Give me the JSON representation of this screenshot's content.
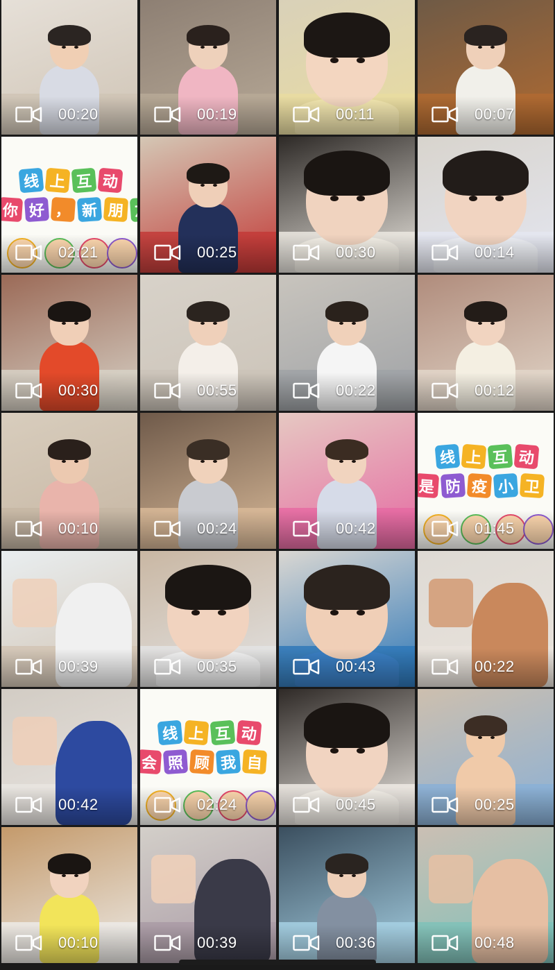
{
  "gallery": {
    "partial_row": [
      {
        "bg": "#d7cfc2"
      },
      {
        "bg": "#6b4d55"
      },
      {
        "bg": "#3e3a36"
      },
      {
        "bg": "#9b6f4a"
      }
    ],
    "tiles": [
      {
        "duration": "00:20",
        "kind": "child",
        "wall": "#e6e0d8",
        "floor": "#cfc4b5",
        "shirt": "#d8dbe4",
        "hair": "#2b2522",
        "skin": "#f0cfb4"
      },
      {
        "duration": "00:19",
        "kind": "child",
        "wall": "#8d7f73",
        "floor": "#b7a997",
        "shirt": "#f0b6c3",
        "hair": "#2a211d",
        "skin": "#eed1bb"
      },
      {
        "duration": "00:11",
        "kind": "closeup",
        "wall": "#d9d1b9",
        "floor": "#e9dca0",
        "shirt": "#f3e7b0",
        "hair": "#1c1714",
        "skin": "#f3d6c0"
      },
      {
        "duration": "00:07",
        "kind": "child",
        "wall": "#6e5a46",
        "floor": "#b06a31",
        "shirt": "#f1f0ea",
        "hair": "#2a2320",
        "skin": "#efd0b9"
      },
      {
        "duration": "02:21",
        "kind": "banner",
        "chars": [
          "线",
          "上",
          "互",
          "动"
        ],
        "chars2": [
          "你",
          "好",
          "，",
          "新",
          "朋",
          "友"
        ]
      },
      {
        "duration": "00:25",
        "kind": "child",
        "wall": "#d4c7b5",
        "floor": "#c23a37",
        "shirt": "#23305a",
        "hair": "#1e1915",
        "skin": "#efcfb8"
      },
      {
        "duration": "00:30",
        "kind": "closeup",
        "wall": "#2e2a27",
        "floor": "#ebe7e0",
        "shirt": "#f3efe6",
        "hair": "#1a1512",
        "skin": "#f0d3bf"
      },
      {
        "duration": "00:14",
        "kind": "closeup",
        "wall": "#d8d4cd",
        "floor": "#e4e6f0",
        "shirt": "#eef0f5",
        "hair": "#221c19",
        "skin": "#f1d4c1"
      },
      {
        "duration": "00:30",
        "kind": "child",
        "wall": "#9b6a57",
        "floor": "#d7d1c6",
        "shirt": "#e34a2a",
        "hair": "#1a1512",
        "skin": "#f0cfb7"
      },
      {
        "duration": "00:55",
        "kind": "child",
        "wall": "#d8d2c9",
        "floor": "#cbc3b8",
        "shirt": "#f4efe9",
        "hair": "#2b241f",
        "skin": "#efd0ba"
      },
      {
        "duration": "00:22",
        "kind": "child",
        "wall": "#c8c4bd",
        "floor": "#9fa2a6",
        "shirt": "#f5f5f5",
        "hair": "#2a221c",
        "skin": "#f0d1ba"
      },
      {
        "duration": "00:12",
        "kind": "child",
        "wall": "#b08c7c",
        "floor": "#e2d6c9",
        "shirt": "#f4efe2",
        "hair": "#231c18",
        "skin": "#f1d4c0"
      },
      {
        "duration": "00:10",
        "kind": "child",
        "wall": "#d8cdbd",
        "floor": "#c6b6a3",
        "shirt": "#e9b4ab",
        "hair": "#2a201b",
        "skin": "#ecc9b0"
      },
      {
        "duration": "00:24",
        "kind": "child",
        "wall": "#6f5a4a",
        "floor": "#d8b998",
        "shirt": "#c9cbd0",
        "hair": "#3a2e25",
        "skin": "#f0d2bb"
      },
      {
        "duration": "00:42",
        "kind": "child",
        "wall": "#e6c8c2",
        "floor": "#e56aa2",
        "shirt": "#d6dbe8",
        "hair": "#3b2c22",
        "skin": "#f1d4bf"
      },
      {
        "duration": "01:45",
        "kind": "banner",
        "chars": [
          "线",
          "上",
          "互",
          "动"
        ],
        "chars2": [
          "是",
          "防",
          "疫",
          "小",
          "卫"
        ]
      },
      {
        "duration": "00:39",
        "kind": "scene",
        "wall": "#e9eef0",
        "floor": "#d2c4b4",
        "shirt": "#f0f0f0",
        "hair": "#2a2420",
        "skin": "#efd0ba"
      },
      {
        "duration": "00:35",
        "kind": "closeup",
        "wall": "#c9b7a3",
        "floor": "#e3e3e3",
        "shirt": "#f2f2f2",
        "hair": "#1b1613",
        "skin": "#f1d3bf"
      },
      {
        "duration": "00:43",
        "kind": "closeup",
        "wall": "#dad7d2",
        "floor": "#2f78b8",
        "shirt": "#3a7fc4",
        "hair": "#2b231e",
        "skin": "#f0cfb7"
      },
      {
        "duration": "00:22",
        "kind": "scene",
        "wall": "#dedad4",
        "floor": "#e9e3dc",
        "shirt": "#c9885c",
        "hair": "#8a5a3b",
        "skin": "#d29a73"
      },
      {
        "duration": "00:42",
        "kind": "scene",
        "wall": "#d2ccc4",
        "floor": "#e9e5e1",
        "shirt": "#2d4aa0",
        "hair": "#2a2420",
        "skin": "#efcfb8"
      },
      {
        "duration": "02:24",
        "kind": "banner",
        "chars": [
          "线",
          "上",
          "互",
          "动"
        ],
        "chars2": [
          "会",
          "照",
          "顾",
          "我",
          "自"
        ]
      },
      {
        "duration": "00:45",
        "kind": "closeup",
        "wall": "#2f2a27",
        "floor": "#eeeae4",
        "shirt": "#f3efe8",
        "hair": "#1a1512",
        "skin": "#f1d4c1"
      },
      {
        "duration": "00:25",
        "kind": "child",
        "wall": "#cdbfae",
        "floor": "#8ab0d6",
        "shirt": "#f0caa9",
        "hair": "#3c2d24",
        "skin": "#f0caa9"
      },
      {
        "duration": "00:10",
        "kind": "child",
        "wall": "#c49a6b",
        "floor": "#eceae6",
        "shirt": "#f2e45a",
        "hair": "#1a1512",
        "skin": "#f1d3bf"
      },
      {
        "duration": "00:39",
        "kind": "scene",
        "wall": "#d3cfc9",
        "floor": "#a99aa5",
        "shirt": "#3a3a48",
        "hair": "#2a2420",
        "skin": "#f0d0b9"
      },
      {
        "duration": "00:36",
        "kind": "child",
        "wall": "#3b4f5f",
        "floor": "#a6d0e3",
        "shirt": "#8390a1",
        "hair": "#2a2420",
        "skin": "#eecfb8"
      },
      {
        "duration": "00:48",
        "kind": "scene",
        "wall": "#cbbfb4",
        "floor": "#7fc1b9",
        "shirt": "#e6bfa3",
        "hair": "#2a2420",
        "skin": "#e6bfa3"
      }
    ]
  },
  "colors": {
    "chip_palette": [
      "#3aa6e0",
      "#f5b324",
      "#5ac05a",
      "#e84a6c",
      "#8e5bd1",
      "#f28b2a"
    ]
  }
}
